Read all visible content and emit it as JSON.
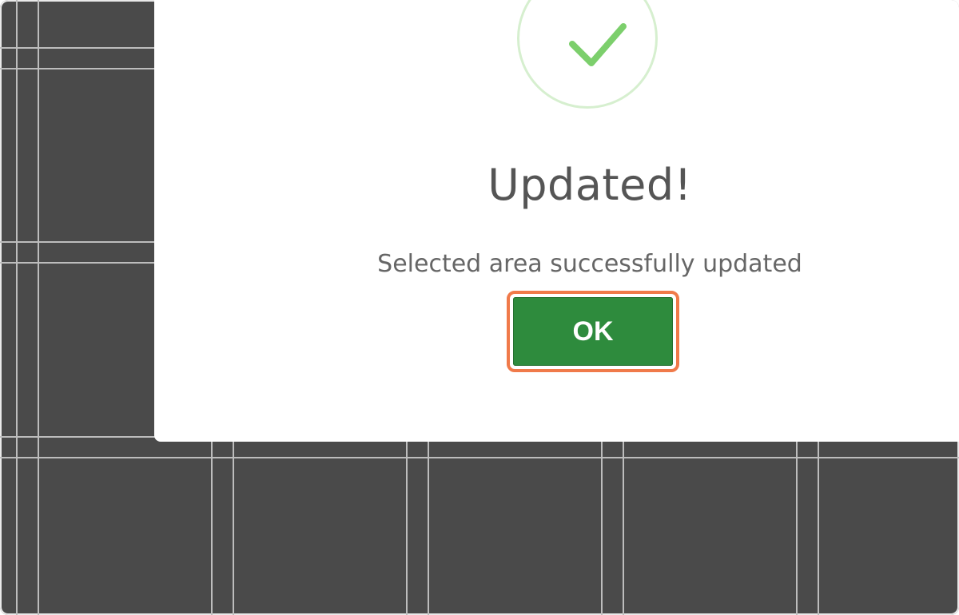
{
  "dialog": {
    "title": "Updated!",
    "message": "Selected area successfully updated",
    "ok_label": "OK",
    "icon": "checkmark-icon"
  },
  "colors": {
    "backdrop": "#4a4a4a",
    "gridline": "#bdbdbd",
    "ok_button": "#2e8b3d",
    "focus_ring": "#f07a4a",
    "checkmark": "#7ccf6c"
  }
}
